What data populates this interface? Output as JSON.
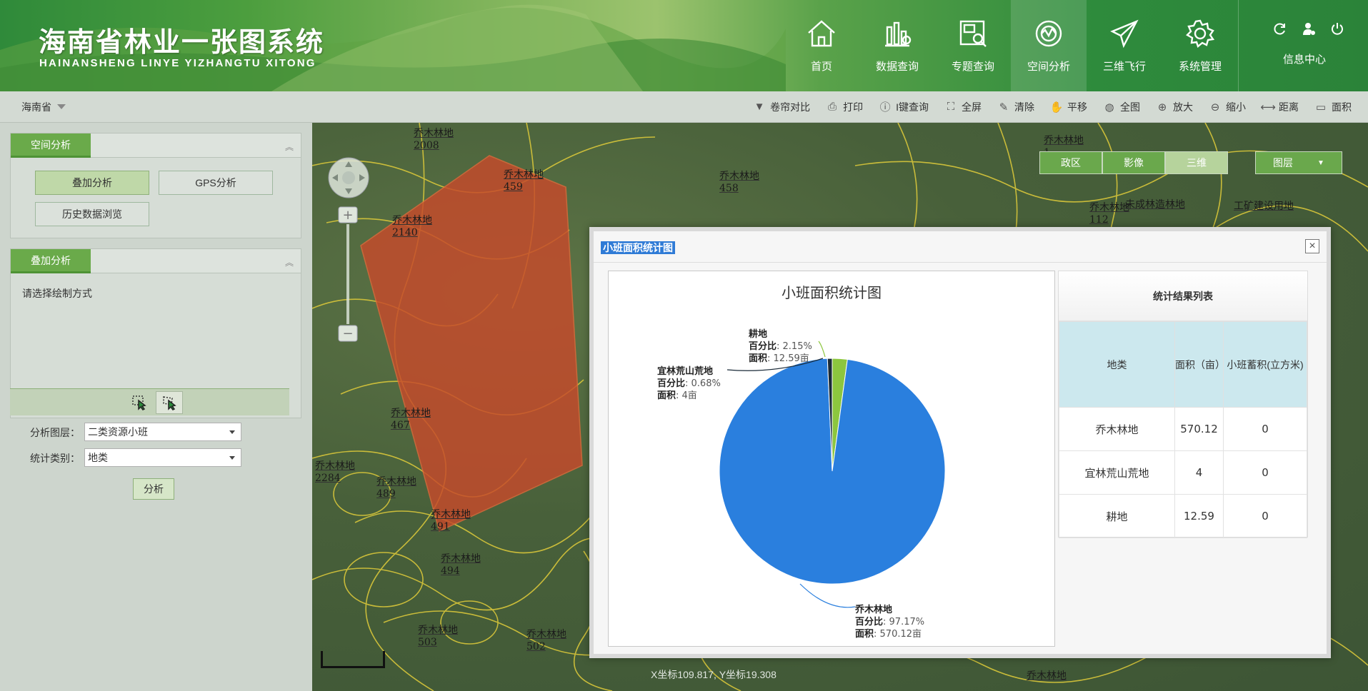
{
  "header": {
    "title_cn": "海南省林业一张图系统",
    "title_en": "HAINANSHENG LINYE YIZHANGTU XITONG",
    "nav": [
      {
        "label": "首页",
        "icon": "home-icon"
      },
      {
        "label": "数据查询",
        "icon": "data-chart-icon"
      },
      {
        "label": "专题查询",
        "icon": "topic-search-icon"
      },
      {
        "label": "空间分析",
        "icon": "spatial-analysis-icon",
        "active": true
      },
      {
        "label": "三维飞行",
        "icon": "paper-plane-icon"
      },
      {
        "label": "系统管理",
        "icon": "gear-icon"
      }
    ],
    "info_center": "信息中心"
  },
  "left": {
    "region": "海南省",
    "panel1": {
      "title": "空间分析",
      "buttons": [
        "叠加分析",
        "GPS分析",
        "历史数据浏览"
      ]
    },
    "panel2": {
      "title": "叠加分析",
      "prompt": "请选择绘制方式",
      "layer_label": "分析图层：",
      "layer_value": "二类资源小班",
      "category_label": "统计类别：",
      "category_value": "地类",
      "analyze": "分析"
    }
  },
  "toolbar": [
    "卷帘对比",
    "打印",
    "I键查询",
    "全屏",
    "清除",
    "平移",
    "全图",
    "放大",
    "缩小",
    "距离",
    "面积"
  ],
  "map": {
    "layers": [
      "政区",
      "影像",
      "三维"
    ],
    "layer_menu": "图层",
    "coords": "X坐标109.817, Y坐标19.308",
    "labels": [
      {
        "t": "乔木林地",
        "sub": "2008"
      },
      {
        "t": "乔木林地",
        "sub": "459"
      },
      {
        "t": "乔木林地",
        "sub": "458"
      },
      {
        "t": "乔木林地",
        "sub": "2140"
      },
      {
        "t": "乔木林地",
        "sub": "1"
      },
      {
        "t": "乔木林地",
        "sub": "467"
      },
      {
        "t": "乔木林地",
        "sub": "2284"
      },
      {
        "t": "乔木林地",
        "sub": "489"
      },
      {
        "t": "乔木林地",
        "sub": "491"
      },
      {
        "t": "乔木林地",
        "sub": "494"
      },
      {
        "t": "乔木林地",
        "sub": "503"
      },
      {
        "t": "乔木林地",
        "sub": "502"
      },
      {
        "t": "乔木林地",
        "sub": "112"
      },
      {
        "t": "未成林造林地",
        "sub": ""
      },
      {
        "t": "工矿建设用地",
        "sub": ""
      }
    ]
  },
  "dialog": {
    "title": "小班面积统计图",
    "close": "×",
    "chart_title": "小班面积统计图",
    "stat_title": "统计结果列表",
    "table": {
      "headers": [
        "地类",
        "面积（亩）",
        "小班蓄积(立方米)"
      ],
      "rows": [
        [
          "乔木林地",
          "570.12",
          "0"
        ],
        [
          "宜林荒山荒地",
          "4",
          "0"
        ],
        [
          "耕地",
          "12.59",
          "0"
        ]
      ]
    }
  },
  "chart_data": {
    "type": "pie",
    "title": "小班面积统计图",
    "slices": [
      {
        "name": "乔木林地",
        "percent": 97.17,
        "area": "570.12亩",
        "color": "#2a7fde"
      },
      {
        "name": "宜林荒山荒地",
        "percent": 0.68,
        "area": "4亩",
        "color": "#1a2a38"
      },
      {
        "name": "耕地",
        "percent": 2.15,
        "area": "12.59亩",
        "color": "#8cc63e"
      }
    ],
    "label_prefix_pct": "百分比",
    "label_prefix_area": "面积"
  }
}
